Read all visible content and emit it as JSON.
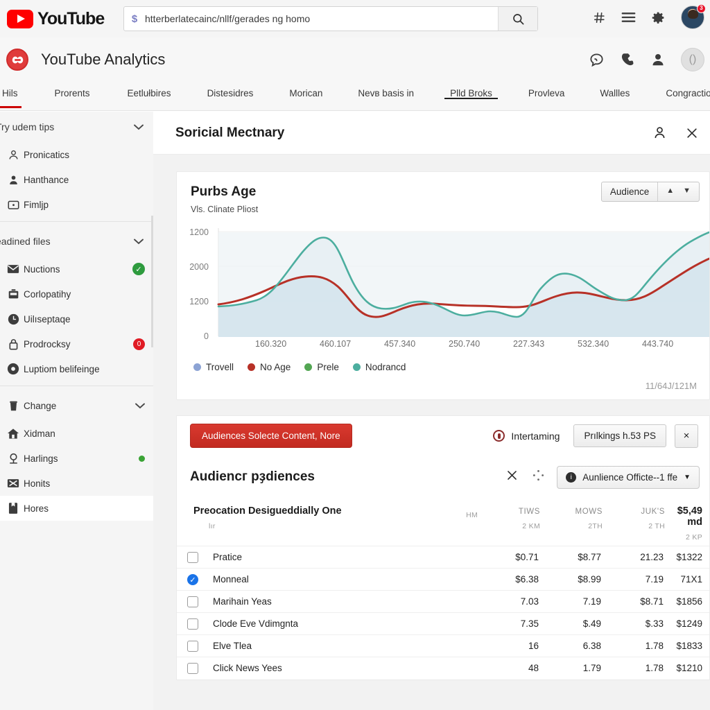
{
  "topbar": {
    "brand": "YouTube",
    "omnibox_value": "htterberlatecainc/nllf/gerades ng homo",
    "omnibox_prefix_icon": "dollar-icon",
    "search_icon": "search-icon",
    "icons": [
      "hash-icon",
      "menu-icon",
      "gear-icon"
    ],
    "avatar_badge": "3"
  },
  "appbar": {
    "title": "YouTube Analytics",
    "logo_icon": "app-logo-icon",
    "icons": [
      "chat-icon",
      "phone-icon",
      "person-icon",
      "ghost-avatar-icon"
    ]
  },
  "tabs": [
    {
      "label": "Hils",
      "state": "active-red"
    },
    {
      "label": "Prorents",
      "state": ""
    },
    {
      "label": "Eetlułbires",
      "state": ""
    },
    {
      "label": "Distesidres",
      "state": ""
    },
    {
      "label": "Morican",
      "state": ""
    },
    {
      "label": "Nevв basis in",
      "state": ""
    },
    {
      "label": "Plld Broks",
      "state": "active-dark"
    },
    {
      "label": "Provleva",
      "state": ""
    },
    {
      "label": "Wallles",
      "state": ""
    },
    {
      "label": "Congraction",
      "state": ""
    }
  ],
  "sidebar": {
    "sections": [
      {
        "header": "Try udem tips",
        "chevron": "chevron-down-icon",
        "items": [
          {
            "label": "Pronicatics",
            "icon": "person-outline-icon",
            "badge": "",
            "badge_type": ""
          },
          {
            "label": "Hanthance",
            "icon": "person-filled-icon",
            "badge": "",
            "badge_type": ""
          },
          {
            "label": "Fimljp",
            "icon": "media-box-icon",
            "badge": "",
            "badge_type": ""
          }
        ]
      },
      {
        "header": "eadined files",
        "chevron": "chevron-down-icon",
        "items": [
          {
            "label": "Nuctions",
            "icon": "mail-icon",
            "badge": "✓",
            "badge_type": "green-check"
          },
          {
            "label": "Corlopatihy",
            "icon": "briefcase-icon",
            "badge": "",
            "badge_type": ""
          },
          {
            "label": "Uilıseptaqe",
            "icon": "clock-icon",
            "badge": "",
            "badge_type": ""
          },
          {
            "label": "Prodrocksy",
            "icon": "lock-icon",
            "badge": "0",
            "badge_type": "red"
          },
          {
            "label": "Luptiom belifeinge",
            "icon": "record-icon",
            "badge": "",
            "badge_type": ""
          }
        ]
      },
      {
        "header": "Change",
        "chevron": "chevron-down-icon",
        "header_icon": "trash-icon",
        "items": [
          {
            "label": "Xidman",
            "icon": "home-icon",
            "badge": "",
            "badge_type": ""
          },
          {
            "label": "Harlings",
            "icon": "pin-icon",
            "badge": "",
            "badge_type": "green-dot"
          },
          {
            "label": "Honits",
            "icon": "envelope-x-icon",
            "badge": "",
            "badge_type": ""
          },
          {
            "label": "Hores",
            "icon": "book-icon",
            "badge": "",
            "badge_type": "",
            "selected": true
          }
        ]
      }
    ]
  },
  "panel": {
    "title": "Soricial Mectnary",
    "person_icon": "person-icon",
    "close_icon": "close-icon"
  },
  "card": {
    "title": "Purbs Age",
    "subtitle": "Vlѕ. Clinate Pliost",
    "control_label": "Audience",
    "control_up_icon": "arrow-up-icon",
    "control_down_icon": "chevron-down-icon",
    "footer": "11/64J/121M"
  },
  "chart_data": {
    "type": "line",
    "title": "Purbs Age",
    "subtitle": "Vlѕ. Clinate Pliost",
    "xlabel": "",
    "ylabel": "",
    "ytick_labels": [
      "1200",
      "2000",
      "1200",
      "0"
    ],
    "ylim": [
      0,
      1200
    ],
    "xtick_labels": [
      "160.320",
      "460.107",
      "457.340",
      "250.740",
      "227.343",
      "532.340",
      "443.740"
    ],
    "grid": true,
    "legend_position": "bottom-left",
    "legend": [
      {
        "name": "Trovell",
        "color": "#8ca3d4"
      },
      {
        "name": "No Age",
        "color": "#b73127"
      },
      {
        "name": "Prele",
        "color": "#53a653"
      },
      {
        "name": "Nodrancd",
        "color": "#4cae9f"
      }
    ],
    "series": [
      {
        "name": "No Age",
        "color": "#b73127",
        "values": [
          580,
          640,
          700,
          760,
          800,
          810,
          780,
          660,
          480,
          430,
          470,
          600,
          660,
          672,
          670,
          668,
          666,
          640,
          600,
          640,
          720,
          760,
          755,
          720,
          690,
          700,
          760,
          850,
          920,
          960,
          980
        ]
      },
      {
        "name": "Nodrancd",
        "color": "#4cae9f",
        "values": [
          540,
          545,
          560,
          600,
          700,
          900,
          1080,
          1140,
          980,
          760,
          620,
          590,
          615,
          640,
          640,
          600,
          540,
          500,
          520,
          560,
          560,
          520,
          470,
          560,
          740,
          830,
          840,
          790,
          700,
          690,
          820,
          1000,
          1075
        ]
      }
    ],
    "area_fill_color": "#d5e5ed"
  },
  "action_strip": {
    "primary_button": "Audiences Solecte Content, Nore",
    "status_icon": "record-ring-icon",
    "status_label": "Intertaming",
    "secondary_button": "Prılkings h.53 PS",
    "close_button": "×"
  },
  "table_panel": {
    "title": "Audiencг pҙdiences",
    "close_icon": "close-icon",
    "drag_icon": "drag-handle-icon",
    "select_label": "Aunlience Officte--1 ffe",
    "select_icon": "info-icon",
    "select_chevron": "chevron-down-icon",
    "header_main": "Preocation Desigueddially One",
    "header_main_sub": "lır",
    "columns": [
      {
        "name": "",
        "sub": "HM"
      },
      {
        "name": "TIWS",
        "sub": "2 KM"
      },
      {
        "name": "MOWS",
        "sub": "2TH"
      },
      {
        "name": "JUK'S",
        "sub": "2 TH"
      },
      {
        "name": "$5,49 md",
        "sub": "2 KР"
      }
    ],
    "rows": [
      {
        "checked": false,
        "name": "Pratice",
        "c1": "",
        "c2": "$0.71",
        "c3": "$8.77",
        "c4": "21.23",
        "c5": "$1322"
      },
      {
        "checked": true,
        "name": "Monneal",
        "c1": "",
        "c2": "$6.38",
        "c3": "$8.99",
        "c4": "7.19",
        "c5": "71X1"
      },
      {
        "checked": false,
        "name": "Marihain Yeas",
        "c1": "",
        "c2": "7.03",
        "c3": "7.19",
        "c4": "$8.71",
        "c5": "$1856"
      },
      {
        "checked": false,
        "name": "Clode Eve Vdimgnta",
        "c1": "",
        "c2": "7.35",
        "c3": "$.49",
        "c4": "$.33",
        "c5": "$1249"
      },
      {
        "checked": false,
        "name": "Elve Tlea",
        "c1": "",
        "c2": "16",
        "c3": "6.38",
        "c4": "1.78",
        "c5": "$1833"
      },
      {
        "checked": false,
        "name": "Click News Yees",
        "c1": "",
        "c2": "48",
        "c3": "1.79",
        "c4": "1.78",
        "c5": "$1210"
      }
    ]
  },
  "colors": {
    "brand_red": "#ff0000",
    "button_red": "#c22a20",
    "accent_blue": "#1a73e8",
    "status_green": "#2e9b3e",
    "badge_red": "#e01b24"
  }
}
